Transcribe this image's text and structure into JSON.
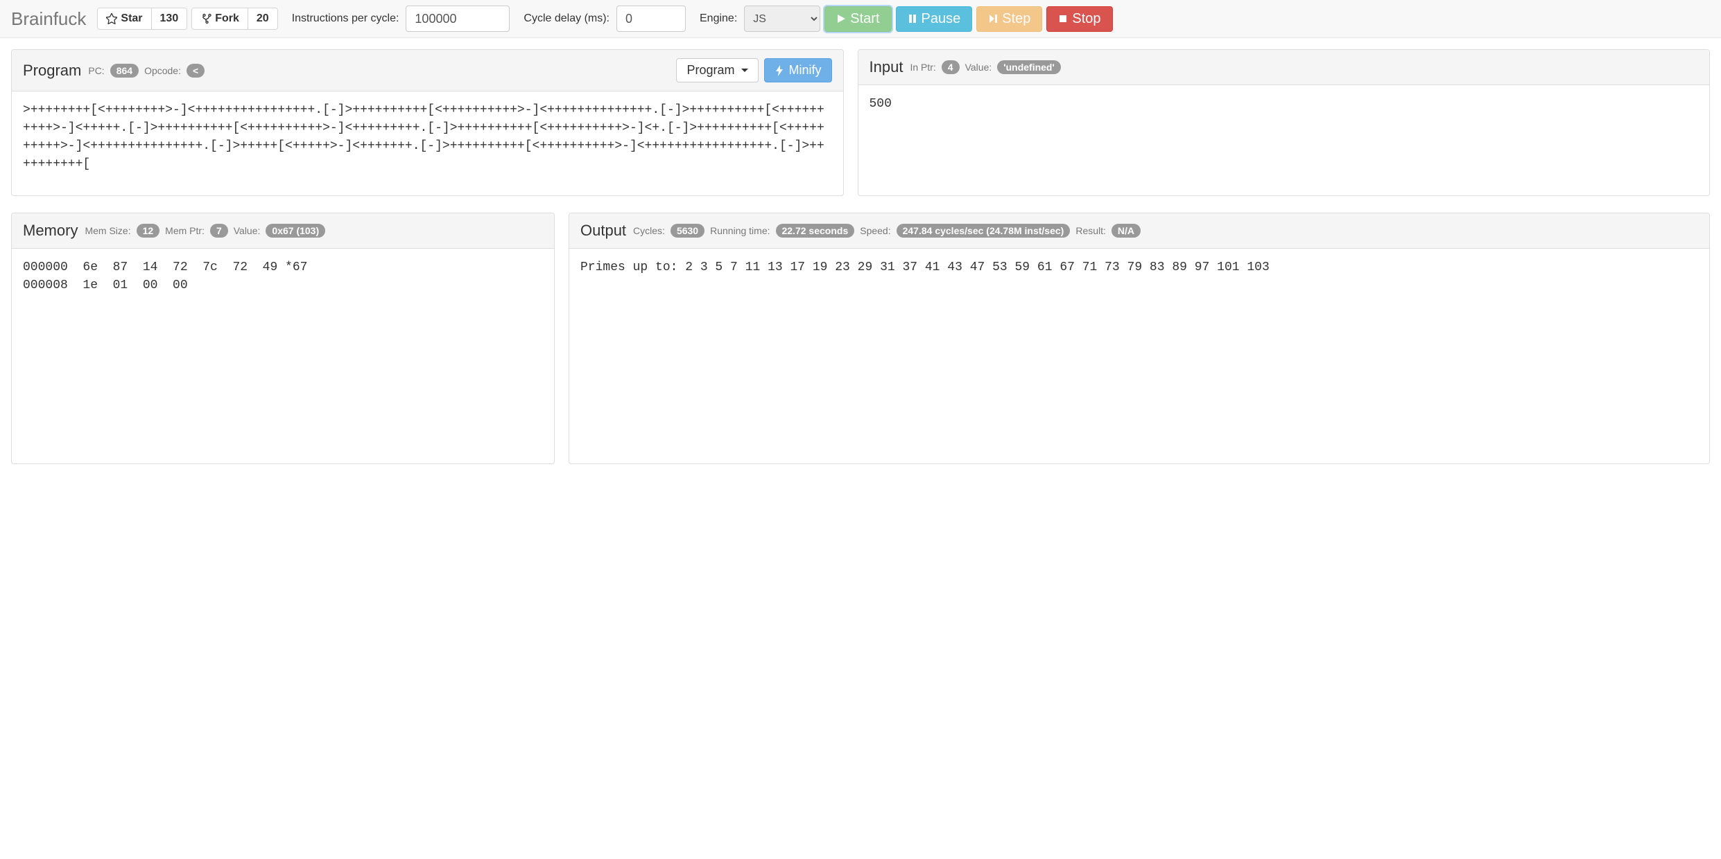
{
  "header": {
    "brand": "Brainfuck",
    "star_label": "Star",
    "star_count": "130",
    "fork_label": "Fork",
    "fork_count": "20",
    "instr_label": "Instructions per cycle:",
    "instr_value": "100000",
    "delay_label": "Cycle delay (ms):",
    "delay_value": "0",
    "engine_label": "Engine:",
    "engine_value": "JS",
    "start": "Start",
    "pause": "Pause",
    "step": "Step",
    "stop": "Stop"
  },
  "program": {
    "title": "Program",
    "pc_label": "PC:",
    "pc": "864",
    "opcode_label": "Opcode:",
    "opcode": "<",
    "dropdown": "Program",
    "minify": "Minify",
    "code": ">++++++++[<++++++++>-]<++++++++++++++++.[-]>++++++++++[<++++++++++>-]<++++++++++++++.[-]>++++++++++[<++++++++++>-]<+++++.[-]>++++++++++[<++++++++++>-]<+++++++++.[-]>++++++++++[<++++++++++>-]<+.[-]>++++++++++[<++++++++++>-]<+++++++++++++++.[-]>+++++[<+++++>-]<+++++++.[-]>++++++++++[<++++++++++>-]<+++++++++++++++++.[-]>++++++++++["
  },
  "input": {
    "title": "Input",
    "ptr_label": "In Ptr:",
    "ptr": "4",
    "value_label": "Value:",
    "value": "'undefined'",
    "content": "500"
  },
  "memory": {
    "title": "Memory",
    "size_label": "Mem Size:",
    "size": "12",
    "ptr_label": "Mem Ptr:",
    "ptr": "7",
    "value_label": "Value:",
    "value": "0x67 (103)",
    "dump": "000000  6e  87  14  72  7c  72  49 *67\n000008  1e  01  00  00"
  },
  "output": {
    "title": "Output",
    "cycles_label": "Cycles:",
    "cycles": "5630",
    "time_label": "Running time:",
    "time": "22.72 seconds",
    "speed_label": "Speed:",
    "speed": "247.84 cycles/sec (24.78M inst/sec)",
    "result_label": "Result:",
    "result": "N/A",
    "content": "Primes up to: 2 3 5 7 11 13 17 19 23 29 31 37 41 43 47 53 59 61 67 71 73 79 83 89 97 101 103"
  }
}
